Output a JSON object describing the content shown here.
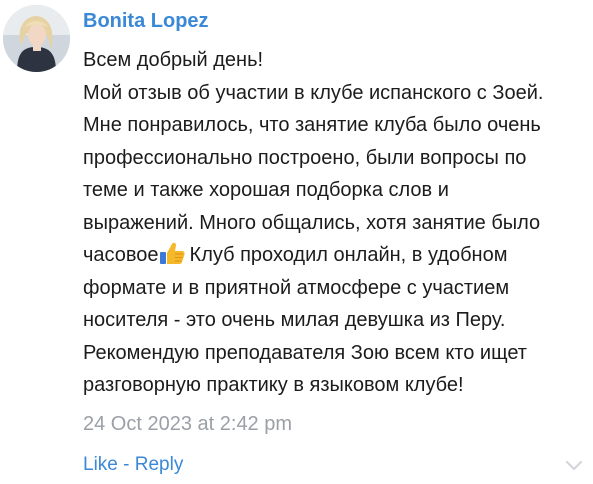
{
  "comment": {
    "author": "Bonita Lopez",
    "lines": [
      "Всем добрый день!",
      "Мой отзыв об участии в клубе испанского с Зоей.",
      "Мне понравилось, что занятие клуба было очень",
      "профессионально построено, были вопросы по",
      "теме и также хорошая подборка слов и",
      "выражений. Много общались, хотя занятие было",
      "часовое",
      "Клуб проходил онлайн, в удобном",
      "формате и в приятной атмосфере с участием",
      "носителя - это очень милая девушка из Перу.",
      "Рекомендую преподавателя Зою всем кто ищет",
      "разговорную практику в языковом клубе!"
    ],
    "emoji": "thumbs-up-emoji",
    "timestamp": "24 Oct 2023 at 2:42 pm",
    "like_label": "Like",
    "separator": " - ",
    "reply_label": "Reply",
    "expand_icon": "chevron-down-icon"
  },
  "colors": {
    "accent": "#3a88d6",
    "text": "#1c1c1c",
    "muted": "#9aa0a6"
  }
}
